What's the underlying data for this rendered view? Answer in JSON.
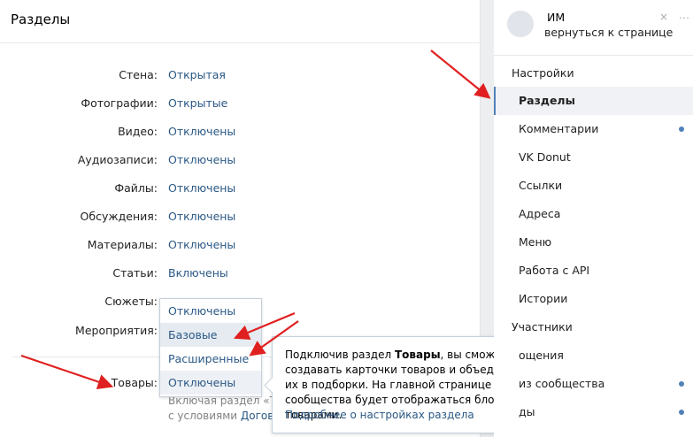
{
  "main": {
    "title": "Разделы",
    "rows": [
      {
        "label": "Стена:",
        "value": "Открытая"
      },
      {
        "label": "Фотографии:",
        "value": "Открытые"
      },
      {
        "label": "Видео:",
        "value": "Отключены"
      },
      {
        "label": "Аудиозаписи:",
        "value": "Отключены"
      },
      {
        "label": "Файлы:",
        "value": "Отключены"
      },
      {
        "label": "Обсуждения:",
        "value": "Отключены"
      },
      {
        "label": "Материалы:",
        "value": "Отключены"
      },
      {
        "label": "Статьи:",
        "value": "Включены"
      },
      {
        "label": "Сюжеты:",
        "value": ""
      },
      {
        "label": "Мероприятия:",
        "value": ""
      },
      {
        "label": "Товары:",
        "value": ""
      }
    ],
    "note_line1": "Включая раздел «То",
    "note_line2_text": "с условиями ",
    "note_line2_link": "Догово"
  },
  "dropdown": {
    "options": [
      "Отключены",
      "Базовые",
      "Расширенные",
      "Отключены"
    ]
  },
  "tooltip": {
    "text_before": "Подключив раздел ",
    "text_bold": "Товары",
    "text_after": ", вы сможете создавать карточки товаров и объединять их в подборки. На главной странице сообщества будет отображаться блок с товарами.",
    "more_link": "Подробнее о настройках раздела"
  },
  "sidebar": {
    "name": "ИМ",
    "back": "вернуться к странице",
    "items": [
      {
        "label": "Настройки",
        "group": true
      },
      {
        "label": "Разделы",
        "active": true
      },
      {
        "label": "Комментарии",
        "dot": true
      },
      {
        "label": "VK Donut"
      },
      {
        "label": "Ссылки"
      },
      {
        "label": "Адреса"
      },
      {
        "label": "Меню"
      },
      {
        "label": "Работа с API"
      },
      {
        "label": "Истории"
      },
      {
        "label": "Участники",
        "group": true
      },
      {
        "label": "ощения"
      },
      {
        "label": "из сообщества",
        "dot": true
      },
      {
        "label": "ды",
        "dot": true
      }
    ]
  },
  "colors": {
    "accent": "#5181b8",
    "link": "#2a5885",
    "arrow": "#e02020"
  }
}
